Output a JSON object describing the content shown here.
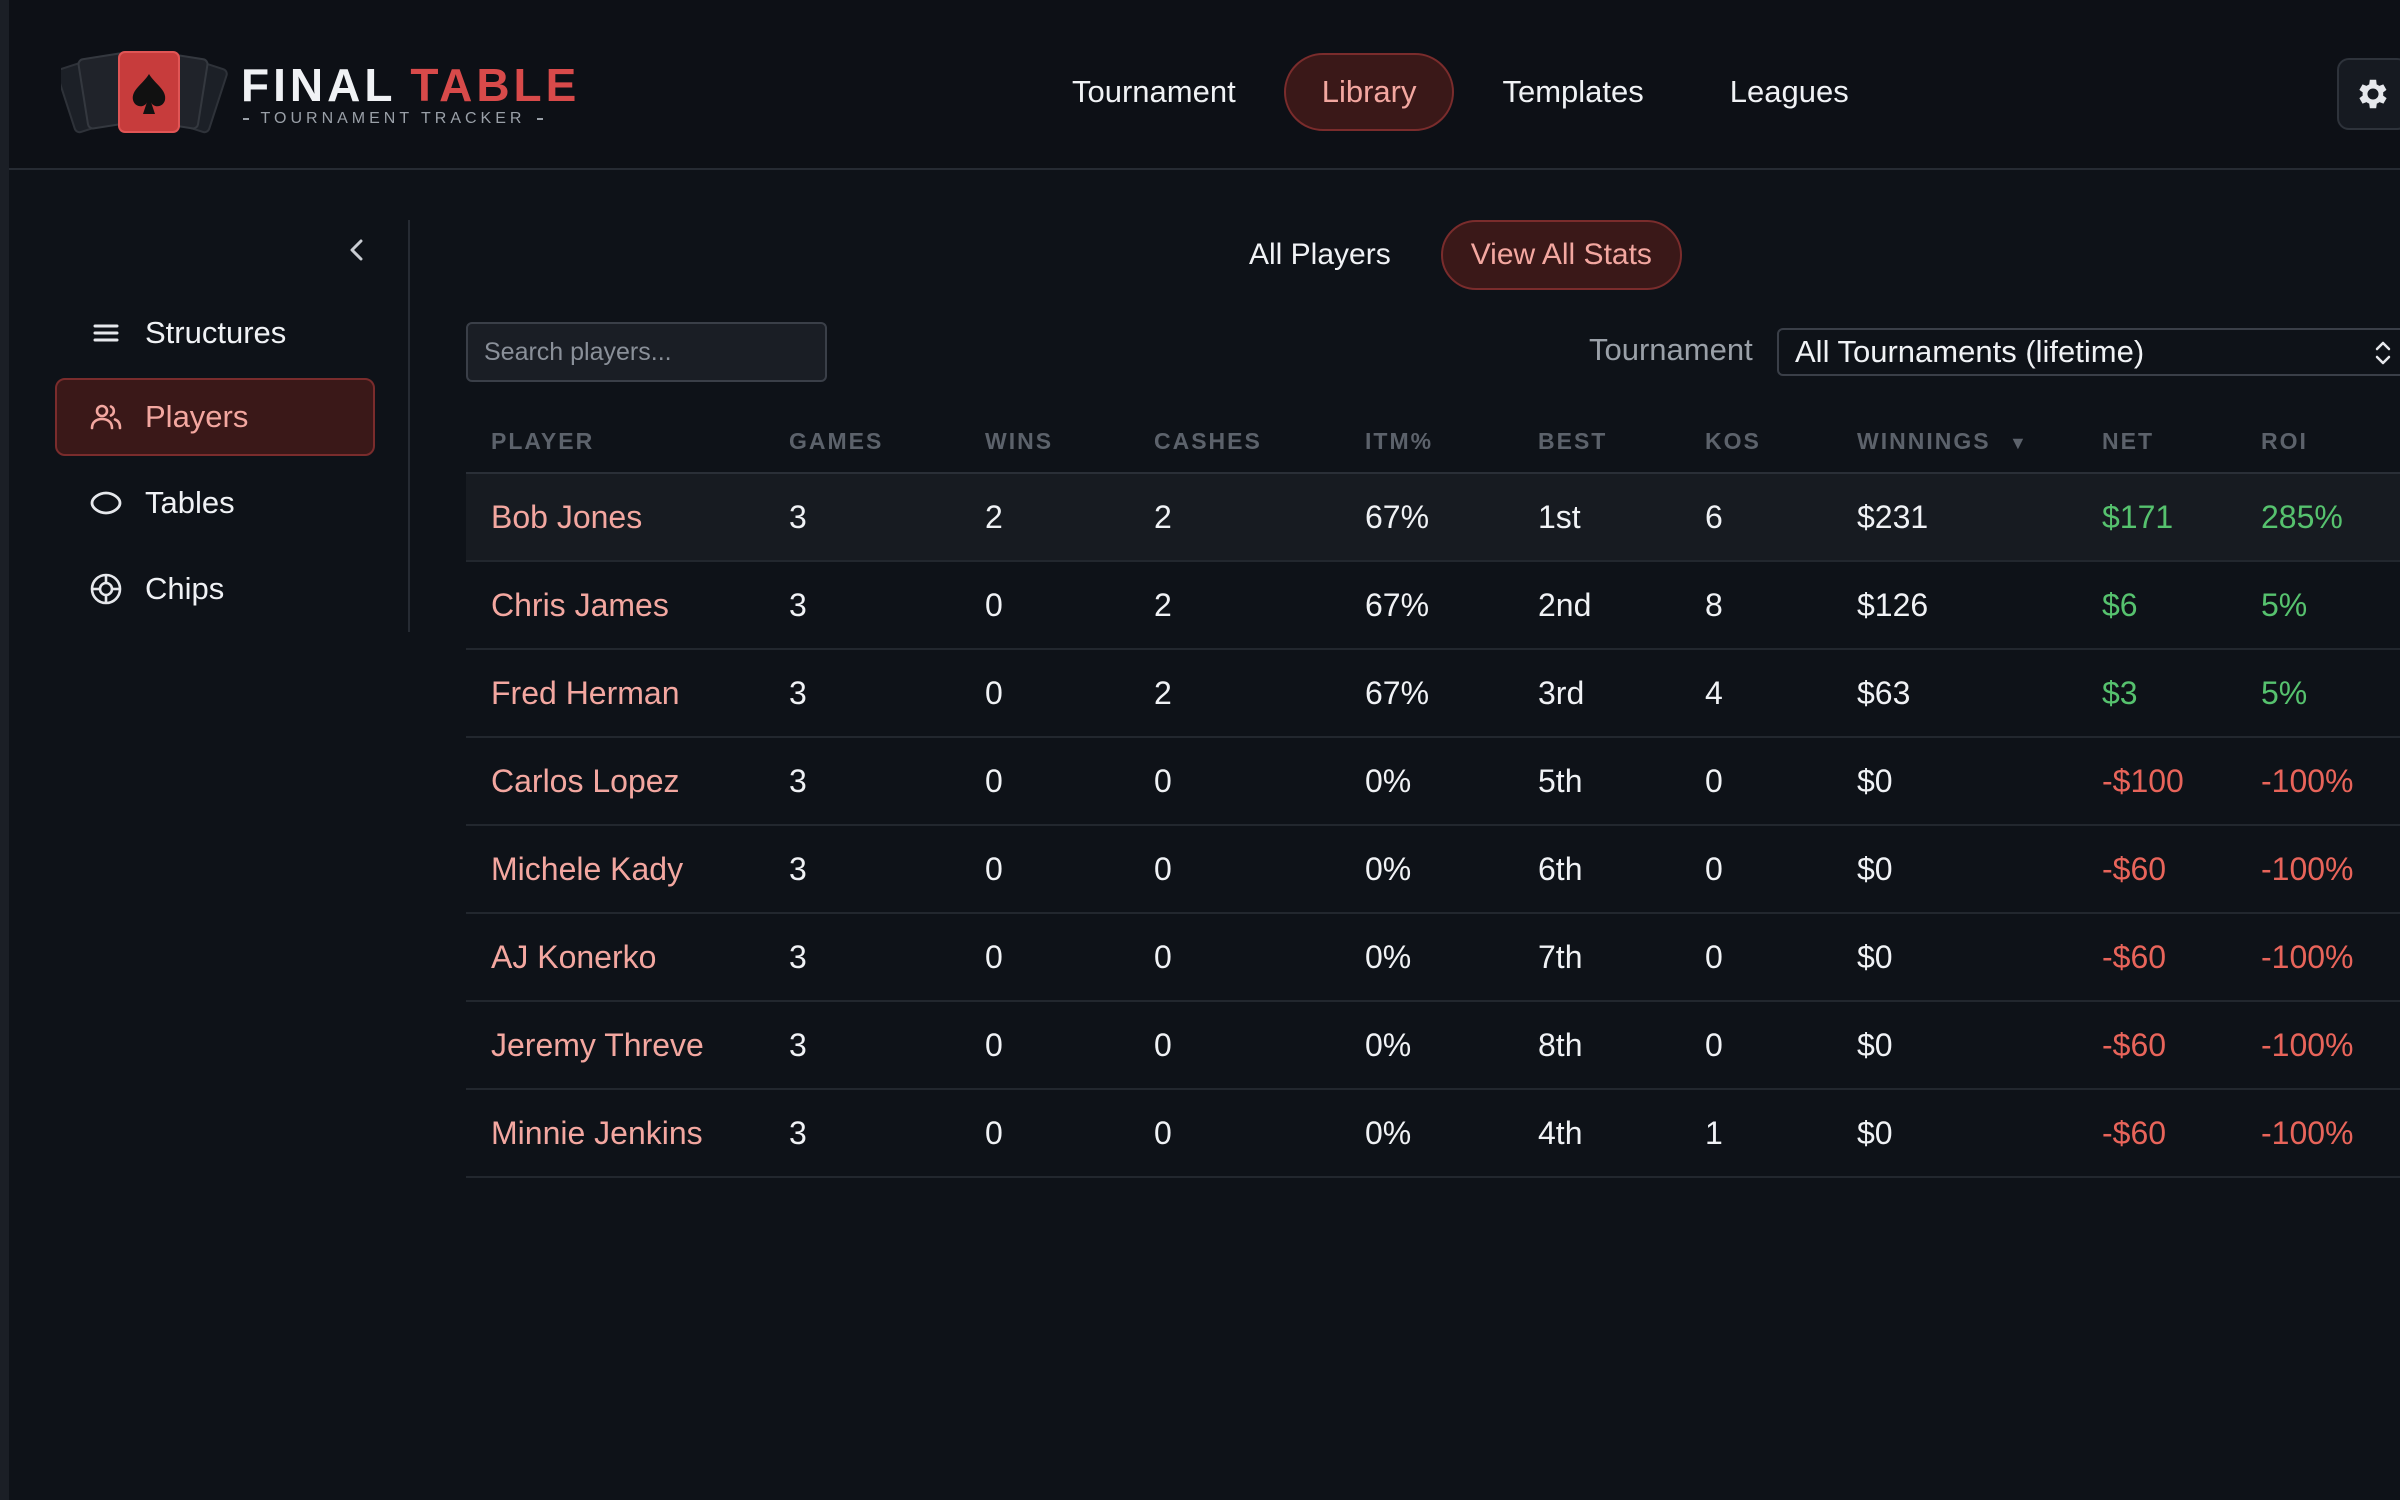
{
  "brand": {
    "title_part1": "FINAL",
    "title_part2": "TABLE",
    "subtitle": "TOURNAMENT TRACKER",
    "accent_color": "#d84a4a"
  },
  "topnav": {
    "items": [
      {
        "label": "Tournament",
        "active": false
      },
      {
        "label": "Library",
        "active": true
      },
      {
        "label": "Templates",
        "active": false
      },
      {
        "label": "Leagues",
        "active": false
      }
    ],
    "settings_icon": "gear-icon"
  },
  "sidebar": {
    "collapse_icon": "chevron-left-icon",
    "items": [
      {
        "label": "Structures",
        "icon": "list-icon",
        "active": false
      },
      {
        "label": "Players",
        "icon": "users-icon",
        "active": true
      },
      {
        "label": "Tables",
        "icon": "table-oval-icon",
        "active": false
      },
      {
        "label": "Chips",
        "icon": "chip-icon",
        "active": false
      }
    ]
  },
  "subtabs": {
    "items": [
      {
        "label": "All Players",
        "active": false
      },
      {
        "label": "View All Stats",
        "active": true
      }
    ]
  },
  "search": {
    "placeholder": "Search players...",
    "value": ""
  },
  "filter": {
    "label": "Tournament",
    "selected": "All Tournaments (lifetime)"
  },
  "table": {
    "headers": {
      "player": "PLAYER",
      "games": "GAMES",
      "wins": "WINS",
      "cashes": "CASHES",
      "itm": "ITM%",
      "best": "BEST",
      "kos": "KOS",
      "winnings": "WINNINGS",
      "net": "NET",
      "roi": "ROI"
    },
    "sort": {
      "column": "winnings",
      "direction": "desc",
      "indicator": "▼"
    },
    "rows": [
      {
        "player": "Bob Jones",
        "games": "3",
        "wins": "2",
        "cashes": "2",
        "itm": "67%",
        "best": "1st",
        "kos": "6",
        "winnings": "$231",
        "net": "$171",
        "roi": "285%",
        "positive": true
      },
      {
        "player": "Chris James",
        "games": "3",
        "wins": "0",
        "cashes": "2",
        "itm": "67%",
        "best": "2nd",
        "kos": "8",
        "winnings": "$126",
        "net": "$6",
        "roi": "5%",
        "positive": true
      },
      {
        "player": "Fred Herman",
        "games": "3",
        "wins": "0",
        "cashes": "2",
        "itm": "67%",
        "best": "3rd",
        "kos": "4",
        "winnings": "$63",
        "net": "$3",
        "roi": "5%",
        "positive": true
      },
      {
        "player": "Carlos Lopez",
        "games": "3",
        "wins": "0",
        "cashes": "0",
        "itm": "0%",
        "best": "5th",
        "kos": "0",
        "winnings": "$0",
        "net": "-$100",
        "roi": "-100%",
        "positive": false
      },
      {
        "player": "Michele Kady",
        "games": "3",
        "wins": "0",
        "cashes": "0",
        "itm": "0%",
        "best": "6th",
        "kos": "0",
        "winnings": "$0",
        "net": "-$60",
        "roi": "-100%",
        "positive": false
      },
      {
        "player": "AJ Konerko",
        "games": "3",
        "wins": "0",
        "cashes": "0",
        "itm": "0%",
        "best": "7th",
        "kos": "0",
        "winnings": "$0",
        "net": "-$60",
        "roi": "-100%",
        "positive": false
      },
      {
        "player": "Jeremy Threve",
        "games": "3",
        "wins": "0",
        "cashes": "0",
        "itm": "0%",
        "best": "8th",
        "kos": "0",
        "winnings": "$0",
        "net": "-$60",
        "roi": "-100%",
        "positive": false
      },
      {
        "player": "Minnie Jenkins",
        "games": "3",
        "wins": "0",
        "cashes": "0",
        "itm": "0%",
        "best": "4th",
        "kos": "1",
        "winnings": "$0",
        "net": "-$60",
        "roi": "-100%",
        "positive": false
      }
    ]
  },
  "colors": {
    "positive": "#56c26e",
    "negative": "#e8645a",
    "player_name": "#f3a7a0",
    "active_bg": "#3a1818",
    "active_border": "#7a2c2c"
  }
}
